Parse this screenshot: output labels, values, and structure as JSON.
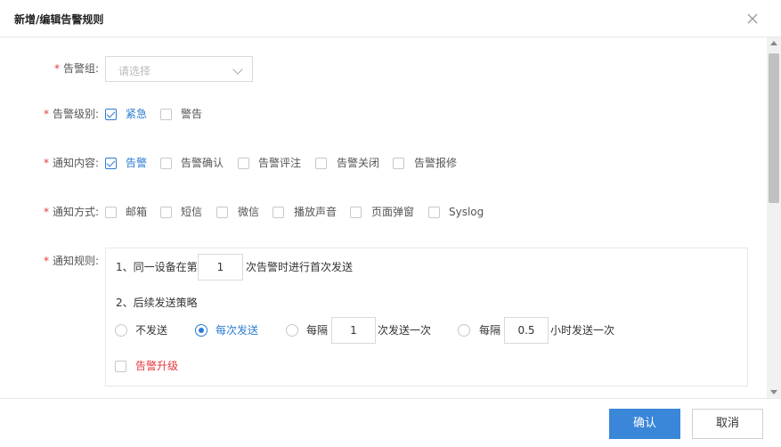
{
  "dialog": {
    "title": "新增/编辑告警规则"
  },
  "form": {
    "group": {
      "label": "告警组:",
      "placeholder": "请选择"
    },
    "level": {
      "label": "告警级别:",
      "options": [
        {
          "label": "紧急",
          "checked": true
        },
        {
          "label": "警告",
          "checked": false
        }
      ]
    },
    "content": {
      "label": "通知内容:",
      "options": [
        {
          "label": "告警",
          "checked": true
        },
        {
          "label": "告警确认",
          "checked": false
        },
        {
          "label": "告警评注",
          "checked": false
        },
        {
          "label": "告警关闭",
          "checked": false
        },
        {
          "label": "告警报修",
          "checked": false
        }
      ]
    },
    "method": {
      "label": "通知方式:",
      "options": [
        {
          "label": "邮箱",
          "checked": false
        },
        {
          "label": "短信",
          "checked": false
        },
        {
          "label": "微信",
          "checked": false
        },
        {
          "label": "播放声音",
          "checked": false
        },
        {
          "label": "页面弹窗",
          "checked": false
        },
        {
          "label": "Syslog",
          "checked": false
        }
      ]
    },
    "rule": {
      "label": "通知规则:",
      "first_prefix": "1、同一设备在第",
      "first_value": "1",
      "first_suffix": "次告警时进行首次发送",
      "strategy_title": "2、后续发送策略",
      "no_send": "不发送",
      "every_send": "每次发送",
      "every_n_prefix": "每隔",
      "every_n_value": "1",
      "every_n_suffix": "次发送一次",
      "every_hour_prefix": "每隔",
      "every_hour_value": "0.5",
      "every_hour_suffix": "小时发送一次",
      "selected": "every_send",
      "escalate": "告警升级",
      "escalate_checked": false
    },
    "required_mark": "*"
  },
  "footer": {
    "confirm": "确认",
    "cancel": "取消"
  },
  "colors": {
    "accent": "#3a86d8",
    "required": "#e4393c"
  }
}
